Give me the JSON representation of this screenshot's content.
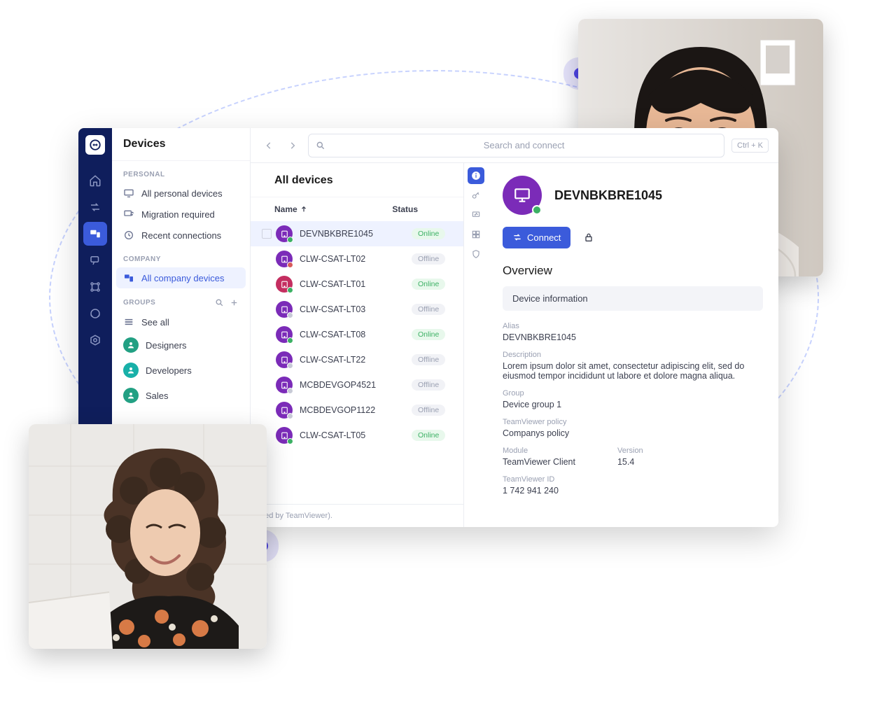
{
  "decor": {
    "photo1_alt": "person-photo-1",
    "photo2_alt": "person-photo-2"
  },
  "app": {
    "section_title": "Devices",
    "search_placeholder": "Search and connect",
    "keyboard_hint": "Ctrl + K",
    "footer_text": "ded by TeamViewer).",
    "devices_heading": "All devices",
    "th_name": "Name",
    "th_status": "Status"
  },
  "sidebar": {
    "personal_label": "PERSONAL",
    "company_label": "COMPANY",
    "groups_label": "GROUPS",
    "items_personal": [
      {
        "icon": "monitor-icon",
        "label": "All personal devices"
      },
      {
        "icon": "migration-icon",
        "label": "Migration required"
      },
      {
        "icon": "clock-icon",
        "label": "Recent connections"
      }
    ],
    "items_company": [
      {
        "icon": "devices-icon",
        "label": "All company devices"
      }
    ],
    "see_all": "See all",
    "groups": [
      {
        "color": "#22a083",
        "label": "Designers"
      },
      {
        "color": "#18b0a8",
        "label": "Developers"
      },
      {
        "color": "#22a083",
        "label": "Sales"
      }
    ]
  },
  "devices": [
    {
      "name": "DEVNBKBRE1045",
      "status": "Online",
      "color": "#7b2bb8",
      "badge": "#3cb164",
      "selected": true
    },
    {
      "name": "CLW-CSAT-LT02",
      "status": "Offline",
      "color": "#7b2bb8",
      "badge": "#d85b5b"
    },
    {
      "name": "CLW-CSAT-LT01",
      "status": "Online",
      "color": "#c42e60",
      "badge": "#3cb164"
    },
    {
      "name": "CLW-CSAT-LT03",
      "status": "Offline",
      "color": "#7b2bb8",
      "badge": "#c7cad6"
    },
    {
      "name": "CLW-CSAT-LT08",
      "status": "Online",
      "color": "#7b2bb8",
      "badge": "#3cb164"
    },
    {
      "name": "CLW-CSAT-LT22",
      "status": "Offline",
      "color": "#7b2bb8",
      "badge": "#c7cad6"
    },
    {
      "name": "MCBDEVGOP4521",
      "status": "Offline",
      "color": "#7b2bb8",
      "badge": "#c7cad6"
    },
    {
      "name": "MCBDEVGOP1122",
      "status": "Offline",
      "color": "#7b2bb8",
      "badge": "#c7cad6"
    },
    {
      "name": "CLW-CSAT-LT05",
      "status": "Online",
      "color": "#7b2bb8",
      "badge": "#3cb164"
    }
  ],
  "detail": {
    "name": "DEVNBKBRE1045",
    "connect_label": "Connect",
    "overview_heading": "Overview",
    "info_tab": "Device information",
    "alias_lbl": "Alias",
    "alias_val": "DEVNBKBRE1045",
    "desc_lbl": "Description",
    "desc_val": "Lorem ipsum dolor sit amet, consectetur adipiscing elit, sed do eiusmod tempor incididunt ut labore et dolore magna aliqua.",
    "group_lbl": "Group",
    "group_val": "Device group 1",
    "policy_lbl": "TeamViewer policy",
    "policy_val": "Companys policy",
    "module_lbl": "Module",
    "module_val": "TeamViewer Client",
    "version_lbl": "Version",
    "version_val": "15.4",
    "tvid_lbl": "TeamViewer ID",
    "tvid_val": "1 742 941 240"
  }
}
